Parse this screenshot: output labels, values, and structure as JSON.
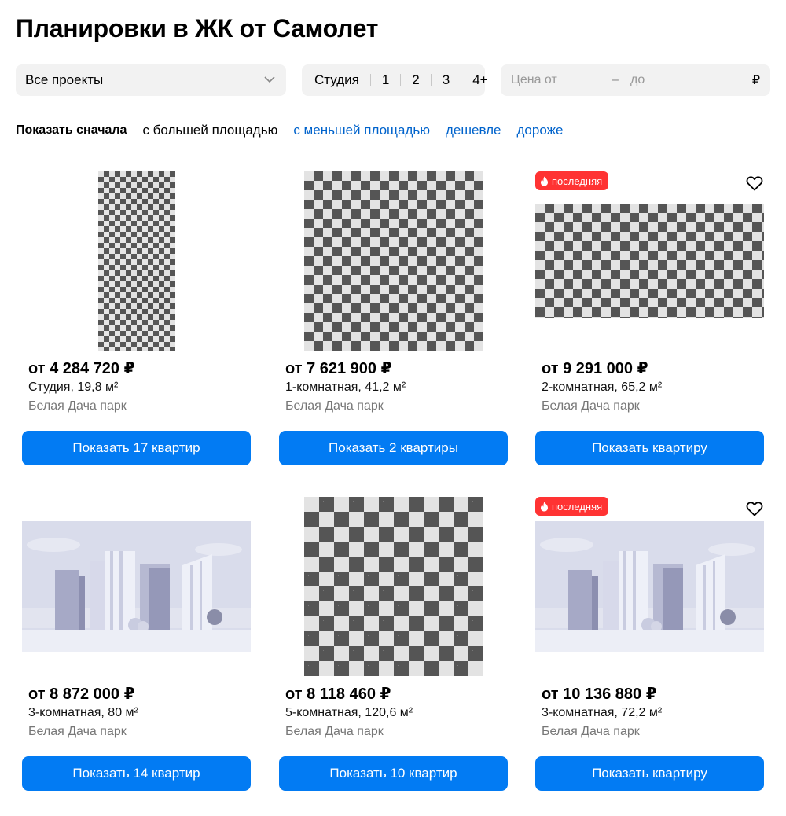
{
  "page_title": "Планировки в ЖК от Самолет",
  "filters": {
    "project": "Все проекты",
    "rooms": [
      "Студия",
      "1",
      "2",
      "3",
      "4+"
    ],
    "price_from_placeholder": "Цена от",
    "price_dash": "–",
    "price_to_placeholder": "до",
    "currency": "₽"
  },
  "sort": {
    "label": "Показать сначала",
    "options": [
      "с большей площадью",
      "с меньшей площадью",
      "дешевле",
      "дороже"
    ]
  },
  "cards": [
    {
      "price": "от 4 284 720 ₽",
      "rooms": "Студия, 19,8 м²",
      "complex": "Белая Дача парк",
      "button": "Показать 17 квартир"
    },
    {
      "price": "от 7 621 900 ₽",
      "rooms": "1-комнатная, 41,2 м²",
      "complex": "Белая Дача парк",
      "button": "Показать 2 квартиры"
    },
    {
      "price": "от 9 291 000 ₽",
      "rooms": "2-комнатная, 65,2 м²",
      "complex": "Белая Дача парк",
      "button": "Показать квартиру",
      "badge": "последняя"
    },
    {
      "price": "от 8 872 000 ₽",
      "rooms": "3-комнатная, 80 м²",
      "complex": "Белая Дача парк",
      "button": "Показать 14 квартир"
    },
    {
      "price": "от 8 118 460 ₽",
      "rooms": "5-комнатная, 120,6 м²",
      "complex": "Белая Дача парк",
      "button": "Показать 10 квартир"
    },
    {
      "price": "от 10 136 880 ₽",
      "rooms": "3-комнатная, 72,2 м²",
      "complex": "Белая Дача парк",
      "button": "Показать квартиру",
      "badge": "последняя"
    }
  ],
  "colors": {
    "accent": "#027bf3",
    "link": "#0063cc",
    "badge": "#ff3333"
  }
}
